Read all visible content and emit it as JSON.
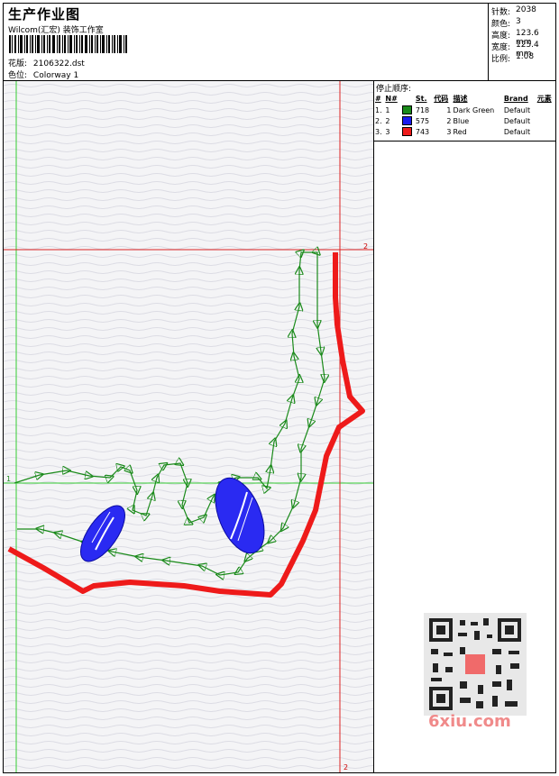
{
  "header": {
    "title": "生产作业图",
    "company": "Wilcom(汇宏) 装饰工作室",
    "design_label": "花版:",
    "design_value": "2106322.dst",
    "colorway_label": "色位:",
    "colorway_value": "Colorway 1"
  },
  "stats": {
    "stitches_label": "针数:",
    "stitches_value": "2038",
    "colors_label": "颜色:",
    "colors_value": "3",
    "height_label": "高度:",
    "height_value": "123.6 mm",
    "width_label": "宽度:",
    "width_value": "125.4 mm",
    "scale_label": "比例:",
    "scale_value": "1.08"
  },
  "stop_sequence": {
    "title": "停止顺序:",
    "columns": [
      "#",
      "N#",
      "St.",
      "代码",
      "描述",
      "Brand",
      "元素"
    ],
    "rows": [
      {
        "num": "1.",
        "n": "1",
        "st": "718",
        "code": "1",
        "desc": "Dark Green",
        "brand": "Default",
        "color": "#1a8a1a"
      },
      {
        "num": "2.",
        "n": "2",
        "st": "575",
        "code": "2",
        "desc": "Blue",
        "brand": "Default",
        "color": "#1a1aee"
      },
      {
        "num": "3.",
        "n": "3",
        "st": "743",
        "code": "3",
        "desc": "Red",
        "brand": "Default",
        "color": "#ee1a1a"
      }
    ]
  },
  "markers": {
    "frame_top": "2",
    "frame_bottom": "2",
    "frame_left": "1"
  },
  "watermark": {
    "text": "6xiu.com"
  },
  "colors": {
    "green": "#1a8a1a",
    "blue": "#1a1aee",
    "red": "#ee1a1a",
    "guide_green": "#33cc33",
    "guide_red": "#dd2222"
  }
}
